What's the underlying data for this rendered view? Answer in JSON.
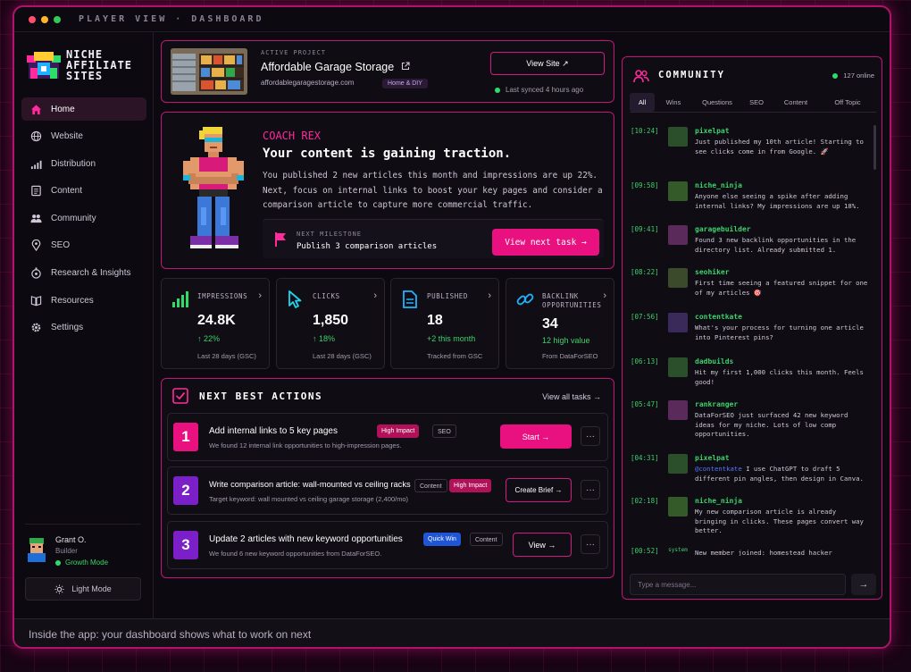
{
  "window": {
    "title": "PLAYER VIEW · DASHBOARD"
  },
  "colors": {
    "accent": "#e8117f",
    "border": "#c2157a",
    "success": "#3bd26b",
    "quickwin": "#1f56d8"
  },
  "sidebar": {
    "logo_lines": [
      "NICHE",
      "AFFILIATE",
      "SITES"
    ],
    "items": [
      {
        "label": "Home",
        "icon": "home-icon"
      },
      {
        "label": "Website",
        "icon": "globe-icon"
      },
      {
        "label": "Distribution",
        "icon": "signal-icon"
      },
      {
        "label": "Content",
        "icon": "document-icon"
      },
      {
        "label": "Community",
        "icon": "people-icon"
      },
      {
        "label": "SEO",
        "icon": "pin-icon"
      },
      {
        "label": "Research & Insights",
        "icon": "research-icon"
      },
      {
        "label": "Resources",
        "icon": "book-icon"
      },
      {
        "label": "Settings",
        "icon": "gear-icon"
      }
    ],
    "user": {
      "name": "Grant O.",
      "role": "Builder",
      "mode": "Growth Mode"
    },
    "light_mode": "Light Mode"
  },
  "project": {
    "label": "ACTIVE PROJECT",
    "name": "Affordable Garage Storage",
    "url": "affordablegaragestorage.com",
    "tag": "Home & DIY",
    "view_site": "View Site ↗",
    "synced": "Last synced 4 hours ago"
  },
  "coach": {
    "name": "COACH REX",
    "headline": "Your content is gaining traction.",
    "body": "You published 2 new articles this month and impressions are up 22%. Next, focus on internal links to boost your key pages and consider a comparison article to capture more commercial traffic.",
    "milestone_label": "NEXT MILESTONE",
    "milestone": "Publish 3 comparison articles",
    "cta": "View next task →"
  },
  "stats": [
    {
      "label": "IMPRESSIONS",
      "value": "24.8K",
      "change": "↑ 22%",
      "sub": "Last 28 days (GSC)",
      "icon": "bars-icon"
    },
    {
      "label": "CLICKS",
      "value": "1,850",
      "change": "↑ 18%",
      "sub": "Last 28 days (GSC)",
      "icon": "cursor-icon"
    },
    {
      "label": "PUBLISHED",
      "value": "18",
      "change": "+2 this month",
      "sub": "Tracked from GSC",
      "icon": "file-icon"
    },
    {
      "label": "BACKLINK OPPORTUNITIES",
      "value": "34",
      "change": "12 high value",
      "sub": "From DataForSEO",
      "icon": "link-icon"
    }
  ],
  "actions": {
    "title": "NEXT BEST ACTIONS",
    "view_all": "View all tasks →",
    "items": [
      {
        "num": "1",
        "title": "Add internal links to 5 key pages",
        "sub": "We found 12 internal link opportunities to high-impression pages.",
        "tags": [
          "High Impact",
          "SEO"
        ],
        "button": "Start →"
      },
      {
        "num": "2",
        "title": "Write comparison article: wall-mounted vs ceiling racks",
        "sub": "Target keyword: wall mounted vs ceiling garage storage (2,400/mo)",
        "tags": [
          "Content",
          "High Impact"
        ],
        "button": "Create Brief →"
      },
      {
        "num": "3",
        "title": "Update 2 articles with new keyword opportunities",
        "sub": "We found 6 new keyword opportunities from DataForSEO.",
        "tags": [
          "Quick Win",
          "Content"
        ],
        "button": "View →"
      }
    ],
    "more": "···"
  },
  "community": {
    "title": "COMMUNITY",
    "online": "127 online",
    "tabs": [
      "All",
      "Wins",
      "Questions",
      "SEO",
      "Content",
      "Off Topic"
    ],
    "messages": [
      {
        "time": "[10:24]",
        "user": "pixelpat",
        "text": "Just published my 10th article! Starting to see clicks come in from Google. 🚀"
      },
      {
        "time": "[09:58]",
        "user": "niche_ninja",
        "text": "Anyone else seeing a spike after adding internal links? My impressions are up 18%."
      },
      {
        "time": "[09:41]",
        "user": "garagebuilder",
        "text": "Found 3 new backlink opportunities in the directory list. Already submitted 1."
      },
      {
        "time": "[08:22]",
        "user": "seohiker",
        "text": "First time seeing a featured snippet for one of my articles 🎯"
      },
      {
        "time": "[07:56]",
        "user": "contentkate",
        "text": "What's your process for turning one article into Pinterest pins?"
      },
      {
        "time": "[06:13]",
        "user": "dadbuilds",
        "text": "Hit my first 1,000 clicks this month. Feels good!"
      },
      {
        "time": "[05:47]",
        "user": "rankranger",
        "text": "DataForSEO just surfaced 42 new keyword ideas for my niche. Lots of low comp opportunities."
      },
      {
        "time": "[04:31]",
        "user": "pixelpat",
        "mention": "@contentkate",
        "text": " I use ChatGPT to draft 5 different pin angles, then design in Canva."
      },
      {
        "time": "[02:18]",
        "user": "niche_ninja",
        "text": "My new comparison article is already bringing in clicks. These pages convert way better."
      },
      {
        "time": "[00:52]",
        "system_label": "system",
        "text": "New member joined: homestead_hacker"
      }
    ],
    "input_placeholder": "Type a message...",
    "send": "→"
  },
  "caption": "Inside the app: your dashboard shows what to work on next"
}
